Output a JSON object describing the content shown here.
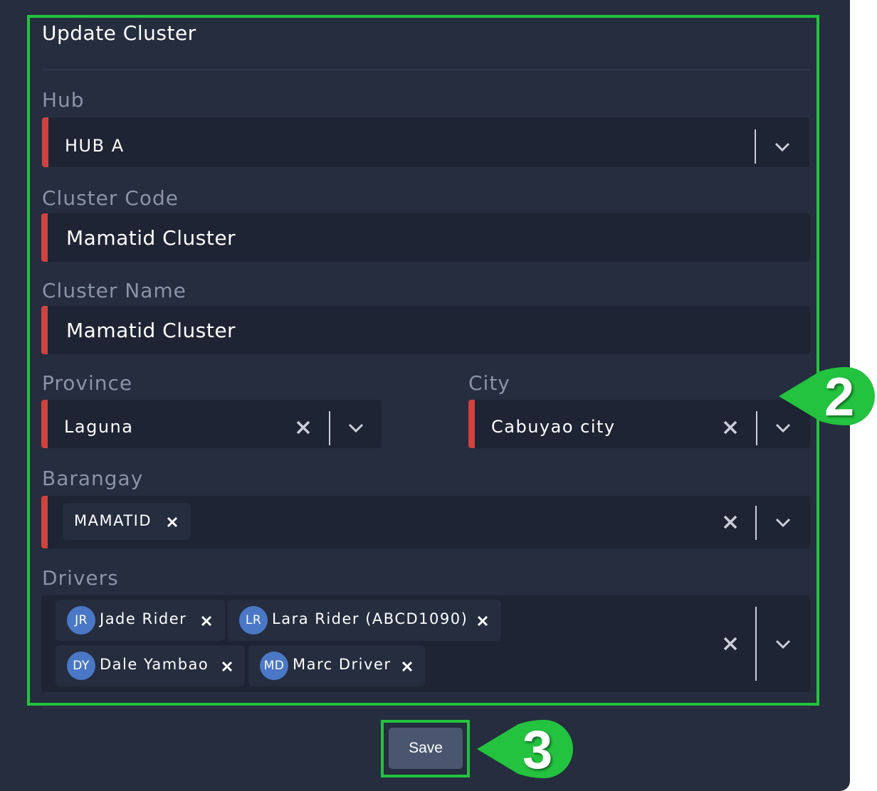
{
  "form": {
    "title": "Update Cluster",
    "hub": {
      "label": "Hub",
      "value": "HUB A"
    },
    "cluster_code": {
      "label": "Cluster Code",
      "value": "Mamatid Cluster"
    },
    "cluster_name": {
      "label": "Cluster Name",
      "value": "Mamatid Cluster"
    },
    "province": {
      "label": "Province",
      "value": "Laguna"
    },
    "city": {
      "label": "City",
      "value": "Cabuyao city"
    },
    "barangay": {
      "label": "Barangay",
      "chips": [
        "MAMATID"
      ]
    },
    "drivers": {
      "label": "Drivers",
      "chips": [
        {
          "initials": "JR",
          "name": "Jade Rider"
        },
        {
          "initials": "LR",
          "name": "Lara Rider (ABCD1090)"
        },
        {
          "initials": "DY",
          "name": "Dale Yambao"
        },
        {
          "initials": "MD",
          "name": "Marc Driver"
        }
      ]
    },
    "save_label": "Save"
  },
  "annotations": {
    "callout_2": "2",
    "callout_3": "3"
  },
  "colors": {
    "panel_bg": "#252d3e",
    "field_bg": "#1e2433",
    "required_bar": "#d1423f",
    "highlight": "#23c23f",
    "avatar_bg": "#4a78c6",
    "save_bg": "#4a5670"
  },
  "icons": {
    "clear": "close-icon",
    "dropdown": "chevron-down-icon",
    "chip_remove": "close-icon"
  }
}
